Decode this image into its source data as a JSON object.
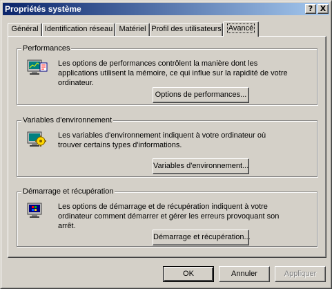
{
  "window": {
    "title": "Propriétés système",
    "help_label": "?",
    "close_label": "X"
  },
  "tabs": [
    {
      "label": "Général",
      "active": false
    },
    {
      "label": "Identification réseau",
      "active": false
    },
    {
      "label": "Matériel",
      "active": false
    },
    {
      "label": "Profil des utilisateurs",
      "active": false
    },
    {
      "label": "Avancé",
      "active": true
    }
  ],
  "groups": [
    {
      "title": "Performances",
      "text": "Les options de performances contrôlent la manière dont les applications utilisent la mémoire, ce qui influe sur la rapidité de votre ordinateur.",
      "button": "Options de performances...",
      "icon": "performance-monitor-icon"
    },
    {
      "title": "Variables d'environnement",
      "text": "Les variables d'environnement indiquent à votre ordinateur où trouver certains types d'informations.",
      "button": "Variables d'environnement...",
      "icon": "environment-variables-icon"
    },
    {
      "title": "Démarrage et récupération",
      "text": "Les options de démarrage et de récupération indiquent à votre ordinateur comment démarrer et gérer les erreurs provoquant son arrêt.",
      "button": "Démarrage et récupération...",
      "icon": "startup-recovery-icon"
    }
  ],
  "footer": {
    "ok_label": "OK",
    "cancel_label": "Annuler",
    "apply_label": "Appliquer",
    "apply_enabled": false
  },
  "colors": {
    "face": "#d4d0c8",
    "title_start": "#0a246a",
    "title_end": "#a6caf0"
  }
}
